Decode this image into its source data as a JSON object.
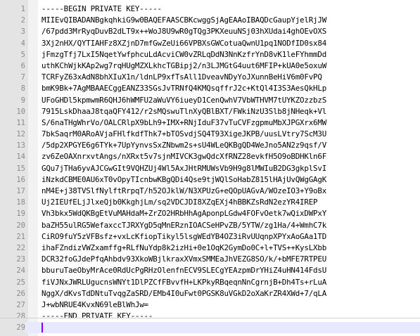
{
  "editor": {
    "lines": [
      {
        "number": "1",
        "text": "-----BEGIN PRIVATE KEY-----"
      },
      {
        "number": "2",
        "text": "MIIEvQIBADANBgkqhkiG9w0BAQEFAASCBKcwggSjAgEAAoIBAQDcGaupYjelRjJW"
      },
      {
        "number": "3",
        "text": "/67pdd3MrRyqDuvB2dLT9x++WoJ8U9wR0gTQg3PKXeuuNSj03hXUdai4ghOEvOXS"
      },
      {
        "number": "4",
        "text": "3Xj2nHX/QYTIAHFz8XZjnD7mfGwZeUi66VPBXsGWCotuaQwnU1pq1NODfID0sx84"
      },
      {
        "number": "5",
        "text": "jFmzgTfj7LxI5NqetYwfphcuLdAcviCW0vZRLqDdN3NnKzfrYnD8vK1leFYhmmDd"
      },
      {
        "number": "6",
        "text": "uthKChWjkKAp2wg7rqHUgMZXLkhcTGBipj2/n3LJMGtG4uut6MFIP+kUA0e5oxuW"
      },
      {
        "number": "7",
        "text": "TCRFyZ63xAdN8bhXIuX1n/ldnLP9xfTsAll1DveavNDyYoJXunnBeHiV6m0FvPQ"
      },
      {
        "number": "8",
        "text": "bmK9Bk+7AgMBAAECggEANZ33SGsJvTRNfQ4KMQsqffrJ2c+KtQl4I3S3AesQkHLp"
      },
      {
        "number": "9",
        "text": "UFoGHDl5kpmwmR6QHJ6hWMFU2aWuVY6iueyD1CenQwhV7VbWTHVM7tUYKZOzzbzS"
      },
      {
        "number": "10",
        "text": "7915LskDhaaJ8tqaQFY412/r2sMQswuTlnXyQBlBXT/FWkiNzU3Slb8jNHeqk+Vl"
      },
      {
        "number": "11",
        "text": "S/6naTHgWhrVo/OALCRlpX9bLh9+IMX+RNjIduF37vTuCVFzgpmuMbXJPGXrx6MW"
      },
      {
        "number": "12",
        "text": "7bkSaqrM0ARoAVjaFHlfkdfThk7+bTOSvdjSQ4T93XigeJKPB/uusLVtry7ScM3U"
      },
      {
        "number": "13",
        "text": "/5dp2XPGYE6g6TYk+7UpYynvsSxZNbwm2s+sU4WLeQKBgQD4WeJno5AN2z9qsf/V"
      },
      {
        "number": "14",
        "text": "zv6ZeOAXnrxvtAngs/nXRxt5v7sjnMIVCK3gwQdcXfRNZ28evkfH5O9oBDHKln6F"
      },
      {
        "number": "15",
        "text": "GQu7jTHa6yvAJCGwGIt9VQHZUj4Wl5AxJHtRMUWsVb9H9g8lMWIuB2DG3gkplSvI"
      },
      {
        "number": "16",
        "text": "iNzkdCBME0AU6xT0vOpyTIcnbwKBgQDi4Qse9tjWQlSoHabZ815lHAjUvQWgGAgK"
      },
      {
        "number": "17",
        "text": "nM4E+j38TVSlfNylftRrpqT/h52OJklW/N3XPUzG+eQOpUAGvA/WOzeIO3+Y9oBx"
      },
      {
        "number": "18",
        "text": "Uj2IEUfELjJlxeQjb0KkghjLm/sq2VDCJDI8XZqEXj4hBBKZsRdN2ezYR4IREP"
      },
      {
        "number": "19",
        "text": "Vh3bkx5WdQKBgEtVuMAHdaM+ZrZO2HRbHhAgAponpLGdw4FOFvOetk7wQixDWPxY"
      },
      {
        "number": "20",
        "text": "baZH55ulRG5WefaxccTJRXYgD5qMnERznIOACSeHPvZB/5YTW/zg1Ha/4+WmhC7k"
      },
      {
        "number": "21",
        "text": "CiRO9fuY5zVFBsfz+vxLcKfiopTikyl5lsgWEdYB4OZ3iRvUUqnpXPYxAoGAa1TD"
      },
      {
        "number": "22",
        "text": "ihaFZndizVWZxamffg+RLfNuYdp8k2izHi+0e1OqK2GymDo0C+l+TVS++KysLXbb"
      },
      {
        "number": "23",
        "text": "DCR32foGJdePfqAhbdv93XkoWBjlkraxXVmxSMMEaJhVEZG8SO/k/+bMFE7RTPEU"
      },
      {
        "number": "24",
        "text": "bburuTaeObyMrAce0RdUcPgRHzOlenfnECV9SLECgYEAzpmDrYHiZ4uHN414FdsU"
      },
      {
        "number": "25",
        "text": "fiVJNxJWRLUgucnsWNYt1DlPZCfFBvvfH+LKPkyRBqeqnNnCgrnjB+Dh4Ts+rLuA"
      },
      {
        "number": "26",
        "text": "NggX/dKvsTdDNtuTvqgZaSRD/EMb4I0uFwt0PGSK8uVGkD2oXaKrZR4XWd+7/qLA"
      },
      {
        "number": "27",
        "text": "J+wbNRUE4KvxN69leBlWhJw="
      },
      {
        "number": "28",
        "text": "-----END PRIVATE KEY-----"
      },
      {
        "number": "29",
        "text": ""
      }
    ]
  }
}
